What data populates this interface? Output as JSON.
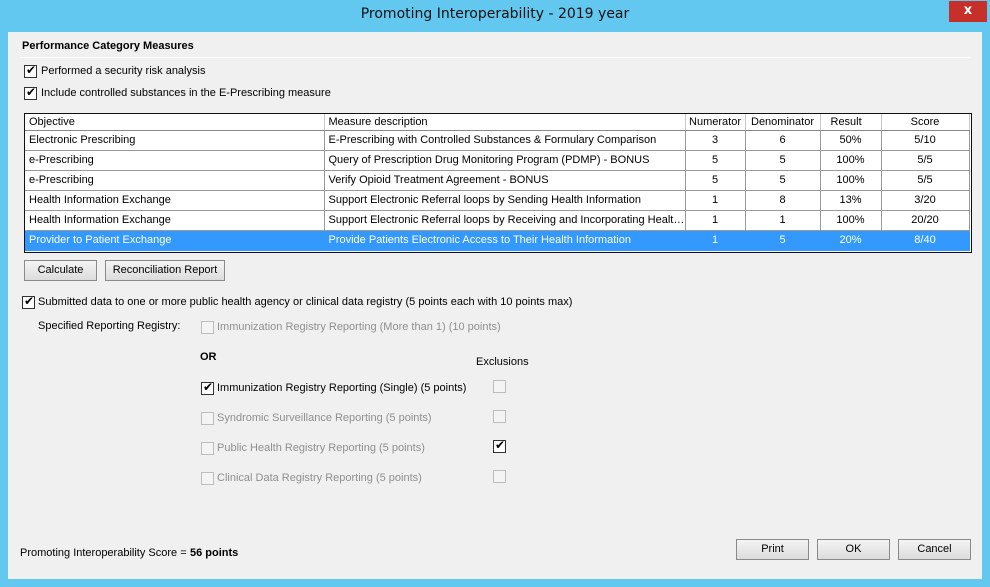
{
  "window": {
    "title": "Promoting Interoperability - 2019 year",
    "close_glyph": "x"
  },
  "section_title": "Performance Category Measures",
  "options": {
    "security_risk": {
      "label": "Performed a security risk analysis",
      "checked": true
    },
    "controlled_substances": {
      "label": "Include controlled substances in the E-Prescribing measure",
      "checked": true
    }
  },
  "table": {
    "headers": [
      "Objective",
      "Measure description",
      "Numerator",
      "Denominator",
      "Result",
      "Score"
    ],
    "rows": [
      {
        "objective": "Electronic Prescribing",
        "description": "E-Prescribing with Controlled Substances & Formulary Comparison",
        "numerator": "3",
        "denominator": "6",
        "result": "50%",
        "score": "5/10",
        "selected": false
      },
      {
        "objective": "e-Prescribing",
        "description": "Query of Prescription Drug Monitoring Program (PDMP) - BONUS",
        "numerator": "5",
        "denominator": "5",
        "result": "100%",
        "score": "5/5",
        "selected": false
      },
      {
        "objective": "e-Prescribing",
        "description": "Verify Opioid Treatment Agreement - BONUS",
        "numerator": "5",
        "denominator": "5",
        "result": "100%",
        "score": "5/5",
        "selected": false
      },
      {
        "objective": "Health Information Exchange",
        "description": "Support Electronic Referral loops by Sending Health Information",
        "numerator": "1",
        "denominator": "8",
        "result": "13%",
        "score": "3/20",
        "selected": false
      },
      {
        "objective": "Health Information Exchange",
        "description": "Support Electronic Referral loops by Receiving and Incorporating Health I...",
        "numerator": "1",
        "denominator": "1",
        "result": "100%",
        "score": "20/20",
        "selected": false
      },
      {
        "objective": "Provider to Patient Exchange",
        "description": "Provide Patients Electronic Access to Their Health Information",
        "numerator": "1",
        "denominator": "5",
        "result": "20%",
        "score": "8/40",
        "selected": true
      }
    ]
  },
  "buttons": {
    "calculate": "Calculate",
    "reconciliation": "Reconciliation Report",
    "print": "Print",
    "ok": "OK",
    "cancel": "Cancel"
  },
  "registry": {
    "submitted_label": "Submitted data to one or more public health agency or clinical data registry  (5 points each with 10 points max)",
    "submitted_checked": true,
    "specified_label": "Specified Reporting Registry:",
    "multiple_label": "Immunization Registry Reporting (More than 1) (10 points)",
    "or_label": "OR",
    "exclusions_label": "Exclusions",
    "items": [
      {
        "label": "Immunization Registry Reporting (Single) (5 points)",
        "checked": true,
        "enabled": true,
        "exclusion": false
      },
      {
        "label": "Syndromic Surveillance Reporting (5 points)",
        "checked": false,
        "enabled": false,
        "exclusion": false
      },
      {
        "label": "Public Health Registry Reporting (5 points)",
        "checked": false,
        "enabled": false,
        "exclusion": true
      },
      {
        "label": "Clinical Data Registry Reporting (5 points)",
        "checked": false,
        "enabled": false,
        "exclusion": false
      }
    ]
  },
  "score": {
    "label": "Promoting Interoperability Score =",
    "value": "56 points"
  },
  "check_glyph": "✔",
  "colors": {
    "title_bar": "#63c8ef",
    "close_button": "#c7302a",
    "selection": "#3399ff",
    "dialog_bg": "#f0f0f0"
  }
}
